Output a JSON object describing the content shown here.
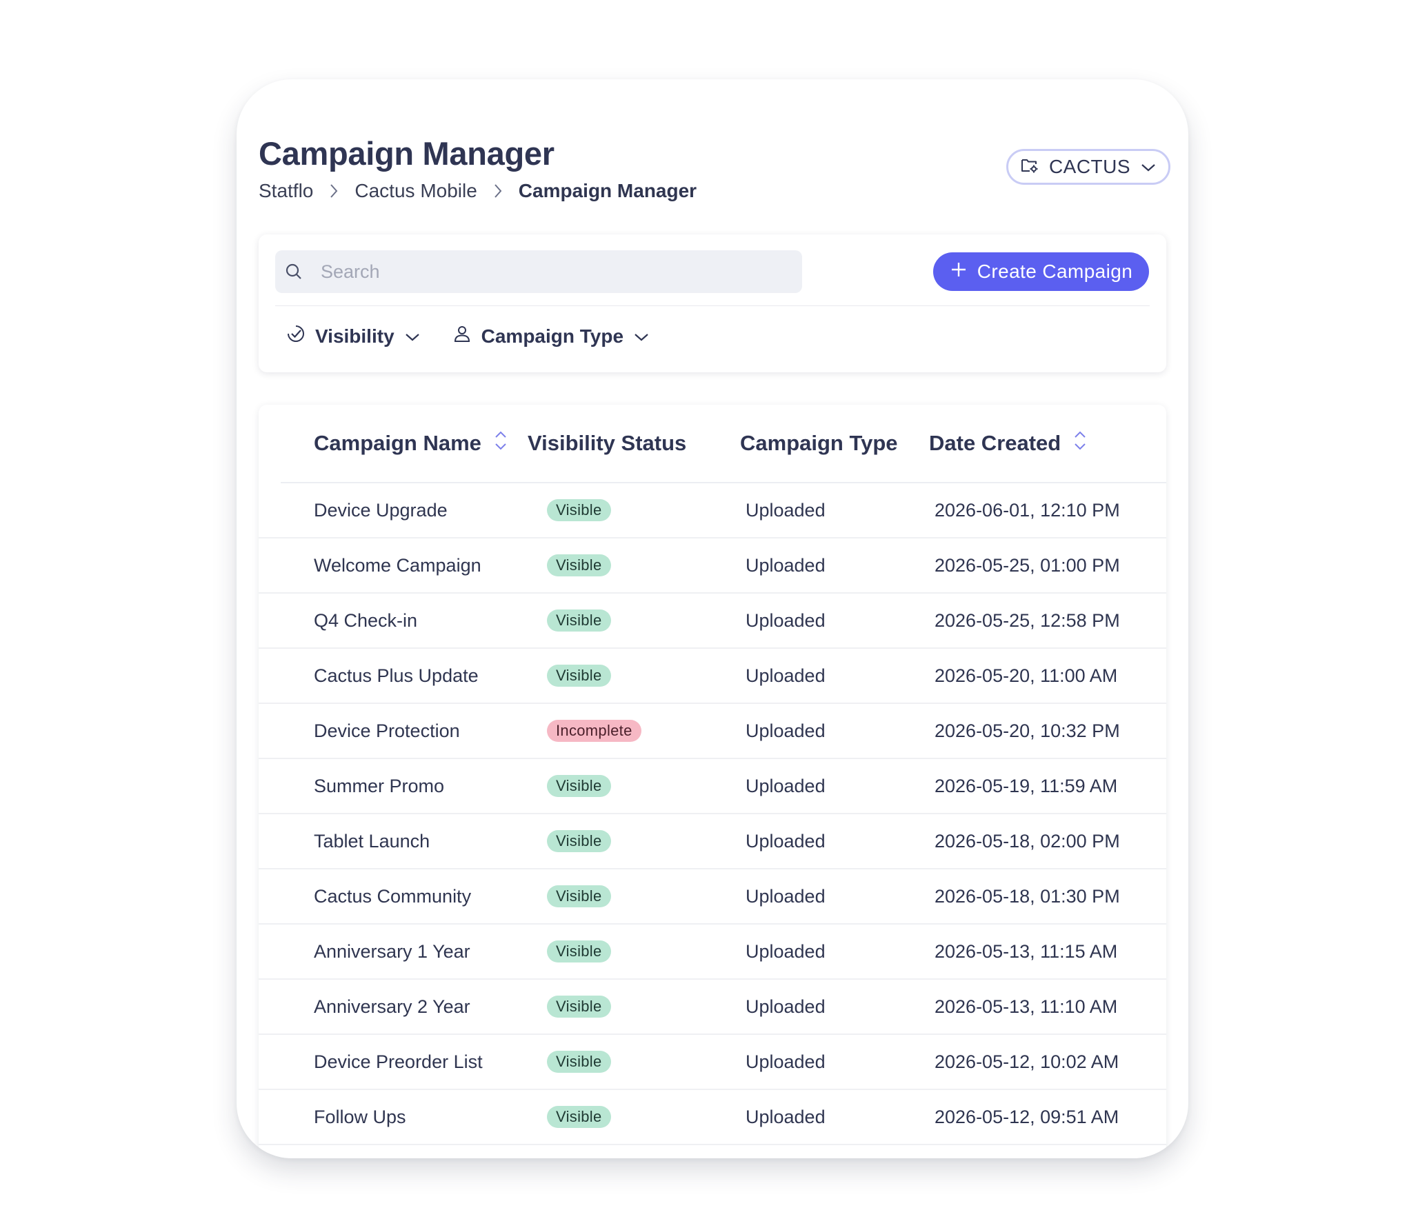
{
  "header": {
    "title": "Campaign Manager",
    "breadcrumb": [
      "Statflo",
      "Cactus Mobile",
      "Campaign Manager"
    ],
    "org_selector": {
      "label": "CACTUS",
      "icon": "folder-settings-icon"
    }
  },
  "toolbar": {
    "search_placeholder": "Search",
    "create_button": "Create Campaign",
    "filters": [
      {
        "label": "Visibility",
        "icon": "check-badge-icon"
      },
      {
        "label": "Campaign Type",
        "icon": "user-icon"
      }
    ]
  },
  "colors": {
    "accent": "#5b5ff0",
    "visible_badge": "#b9e6d3",
    "incomplete_badge": "#f6b8c4",
    "text": "#2f3553"
  },
  "table": {
    "columns": [
      "Campaign Name",
      "Visibility Status",
      "Campaign Type",
      "Date Created"
    ],
    "rows": [
      {
        "name": "Device Upgrade",
        "status": "Visible",
        "type": "Uploaded",
        "date": "2026-06-01, 12:10 PM"
      },
      {
        "name": "Welcome Campaign",
        "status": "Visible",
        "type": "Uploaded",
        "date": "2026-05-25, 01:00 PM"
      },
      {
        "name": "Q4 Check-in",
        "status": "Visible",
        "type": "Uploaded",
        "date": "2026-05-25, 12:58 PM"
      },
      {
        "name": "Cactus Plus Update",
        "status": "Visible",
        "type": "Uploaded",
        "date": "2026-05-20, 11:00 AM"
      },
      {
        "name": "Device Protection",
        "status": "Incomplete",
        "type": "Uploaded",
        "date": "2026-05-20, 10:32 PM"
      },
      {
        "name": "Summer Promo",
        "status": "Visible",
        "type": "Uploaded",
        "date": "2026-05-19, 11:59 AM"
      },
      {
        "name": "Tablet Launch",
        "status": "Visible",
        "type": "Uploaded",
        "date": "2026-05-18, 02:00 PM"
      },
      {
        "name": "Cactus Community",
        "status": "Visible",
        "type": "Uploaded",
        "date": "2026-05-18, 01:30 PM"
      },
      {
        "name": "Anniversary 1 Year",
        "status": "Visible",
        "type": "Uploaded",
        "date": "2026-05-13, 11:15 AM"
      },
      {
        "name": "Anniversary 2 Year",
        "status": "Visible",
        "type": "Uploaded",
        "date": "2026-05-13, 11:10 AM"
      },
      {
        "name": "Device Preorder List",
        "status": "Visible",
        "type": "Uploaded",
        "date": "2026-05-12, 10:02 AM"
      },
      {
        "name": "Follow Ups",
        "status": "Visible",
        "type": "Uploaded",
        "date": "2026-05-12, 09:51 AM"
      }
    ]
  }
}
